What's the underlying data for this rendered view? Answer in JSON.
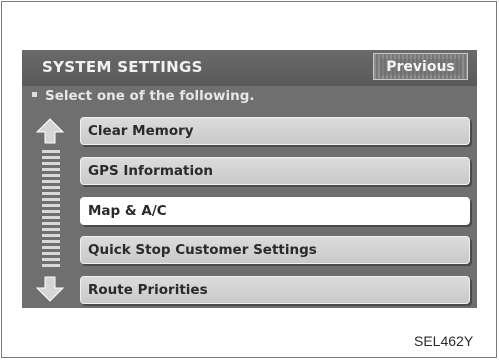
{
  "header": {
    "title": "SYSTEM SETTINGS",
    "previous_label": "Previous"
  },
  "instruction": "Select one of the following.",
  "menu": {
    "items": [
      {
        "label": "Clear Memory",
        "selected": false
      },
      {
        "label": "GPS Information",
        "selected": false
      },
      {
        "label": "Map & A/C",
        "selected": true
      },
      {
        "label": "Quick Stop Customer Settings",
        "selected": false
      },
      {
        "label": "Route Priorities",
        "selected": false
      }
    ]
  },
  "scroll": {
    "up_icon": "arrow-up-icon",
    "down_icon": "arrow-down-icon"
  },
  "figure_code": "SEL462Y",
  "colors": {
    "screen_bg": "#6f6f6f",
    "header_bg": "#5f5f5f",
    "button_bg": "#d4d4d4",
    "selected_bg": "#ffffff",
    "text_light": "#f2f2f2",
    "text_dark": "#2a2a2a"
  }
}
